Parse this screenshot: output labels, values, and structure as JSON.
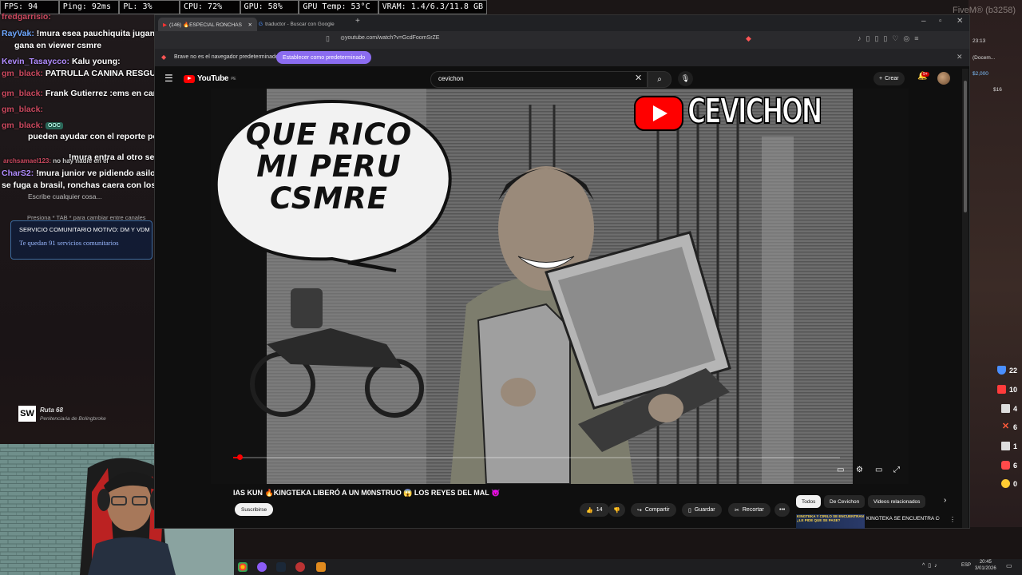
{
  "overlay": {
    "stats": [
      "FPS: 94",
      "Ping: 92ms",
      "PL: 3%",
      "CPU: 72%",
      "GPU: 58%",
      "GPU Temp: 53°C",
      "VRAM: 1.4/6.3/11.8 GB"
    ],
    "fivem_label": "FiveM® (b3258)"
  },
  "chat": {
    "messages": [
      {
        "name": "fredgarrisio:",
        "text": ""
      },
      {
        "name": "RayVak:",
        "text": "!mura esea pauchiquita jugando webadas nos"
      },
      {
        "name": "",
        "text": "gana en viewer csmre"
      },
      {
        "name": "Kevin_Tasaycco:",
        "text": "Kalu young:"
      },
      {
        "name": "gm_black:",
        "text": "PATRULLA CANINA RESGUARDAND"
      },
      {
        "name": "gm_black:",
        "text": "Frank Gutierrez :ems en can"
      },
      {
        "name": "gm_black:",
        "text": ""
      },
      {
        "name": "gm_black:",
        "text": "OOC"
      },
      {
        "name": "gm_black:",
        "text": "pueden ayudar con el reporte por c"
      },
      {
        "name": "",
        "text": "!mura entra al otro servidor ps mi lord"
      },
      {
        "name": "archsamael123:",
        "text": "no hay nadie en el"
      },
      {
        "name": "CharS2:",
        "text": "!mura junior ve pidiendo asilo en bolivia, el gordo ya"
      },
      {
        "name": "",
        "text": "se fuga a brasil, ronchas caera con los fekas a cana"
      }
    ],
    "input_placeholder": "Escribe cualquier cosa...",
    "tab_hint": "Presiona * TAB * para cambiar entre canales",
    "service_title": "SERVICIO COMUNITARIO MOTIVO: DM Y VDM",
    "service_remaining": "Te quedan 91 servicios comunitarios",
    "logo": "SW",
    "route": "Ruta 68",
    "route_sub": "Penitenciaria de Bolingbroke"
  },
  "hud": {
    "top": [
      "23:13",
      "(Docem...",
      "$2,000",
      "$16"
    ],
    "stats": [
      {
        "icon": "shield-icon",
        "value": "22",
        "color": "#4a8fff"
      },
      {
        "icon": "car-icon",
        "value": "10",
        "color": "#ff3b3b"
      },
      {
        "icon": "bank-icon",
        "value": "4",
        "color": "#dddddd"
      },
      {
        "icon": "cross-icon",
        "value": "6",
        "color": "#ff5a3a"
      },
      {
        "icon": "hospital-icon",
        "value": "1",
        "color": "#dddddd"
      },
      {
        "icon": "taxi-icon",
        "value": "6",
        "color": "#ff4a4a"
      },
      {
        "icon": "people-icon",
        "value": "0",
        "color": "#ffcc33"
      }
    ]
  },
  "browser": {
    "tabs": [
      {
        "label": "(146) 🔥ESPECIAL RONCHAS",
        "active": true
      },
      {
        "label": "traductor - Buscar con Google",
        "active": false
      }
    ],
    "url": "youtube.com/watch?v=GcdFoomSrZE",
    "info_text": "Brave no es el navegador predeterminado",
    "info_button": "Establecer como predeterminado"
  },
  "youtube": {
    "logo": "YouTube",
    "logo_country": "PE",
    "search_value": "cevichon",
    "create_label": "Crear",
    "notif_count": "9+",
    "video": {
      "speech": [
        "QUE RICO",
        "MI PERU",
        "CSMRE"
      ],
      "channel_watermark": "CEVICHON",
      "progress": 0.01
    },
    "title": "IAS KUN 🔥KINGTEKA LIBERÓ A UN M0NSTRUO 😱 LOS REYES DEL MAL 😈",
    "subscribe": "Suscribirse",
    "likes": "14",
    "share": "Compartir",
    "save": "Guardar",
    "clip": "Recortar",
    "chips": [
      "Todos",
      "De Cevichon",
      "Videos relacionados"
    ],
    "related_thumb": "KINGTEKA Y CIRILO SE ENCUENTRAN ¿LE PIDE QUE SE PASE?",
    "related_title": "KINGTEKA SE ENCUENTRA CON CIRILO ¿LE PIDE QUE SE"
  },
  "taskbar": {
    "lang": "ESP",
    "time": "20:45",
    "date": "3/01/2026"
  }
}
